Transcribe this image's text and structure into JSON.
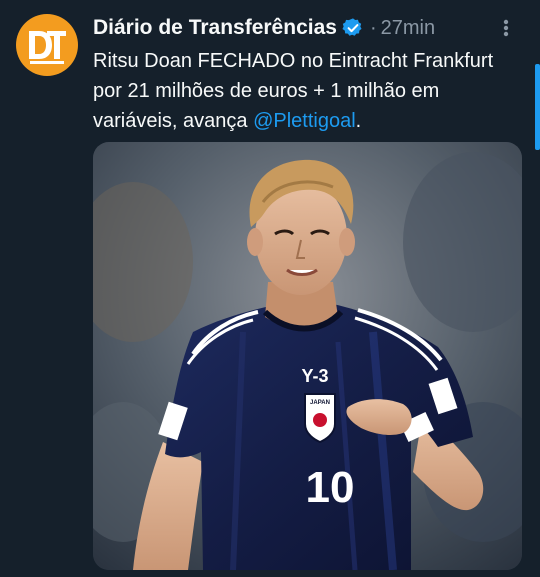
{
  "tweet": {
    "author": {
      "name": "Diário de Transferências",
      "avatar_initials": "DT",
      "verified": true
    },
    "separator": "·",
    "timestamp": "27min",
    "text_before_mention": "Ritsu Doan FECHADO no Eintracht Frankfurt por 21 milhões de euros + 1 milhão em variáveis, avança ",
    "mention": "@Plettigoal",
    "text_after_mention": ".",
    "media": {
      "shirt_brand": "Y-3",
      "shirt_number": "10",
      "crest_text": "JAPAN"
    }
  },
  "colors": {
    "background": "#15202b",
    "accent": "#1d9bf0",
    "avatar": "#f39c1f",
    "muted_text": "#8b98a5"
  },
  "icons": {
    "verified": "verified-badge-icon",
    "more": "more-options-icon"
  }
}
